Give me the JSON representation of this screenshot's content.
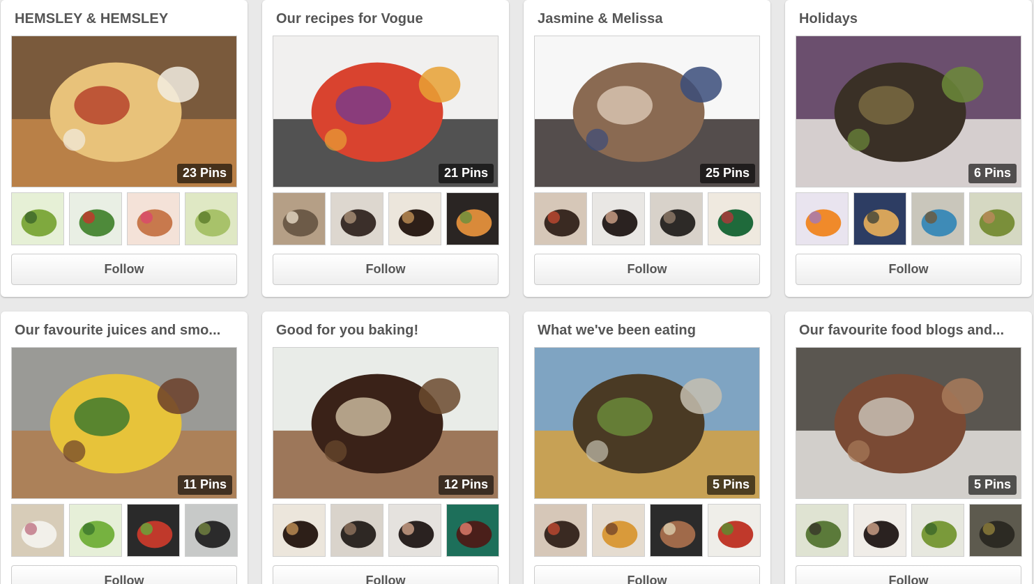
{
  "boards": [
    {
      "title": "HEMSLEY & HEMSLEY",
      "pins_label": "23 Pins",
      "follow_label": "Follow",
      "cover": {
        "image": "pizza-photo",
        "colors": [
          "#7a5a3c",
          "#c98a4a",
          "#e8c27a",
          "#b6432c",
          "#f2ede2"
        ]
      },
      "thumbs": [
        {
          "image": "green-pesto-photo",
          "colors": [
            "#e6f0d6",
            "#7fa93e",
            "#3f6a2a"
          ]
        },
        {
          "image": "salad-photo",
          "colors": [
            "#e9efe4",
            "#4e8a3a",
            "#c0392b"
          ]
        },
        {
          "image": "snacks-photo",
          "colors": [
            "#f4e2d8",
            "#c8794d",
            "#d94b6a"
          ]
        },
        {
          "image": "green-soup-photo",
          "colors": [
            "#dfe8c4",
            "#a8c26a",
            "#5f7f2d"
          ]
        }
      ]
    },
    {
      "title": "Our recipes for Vogue",
      "pins_label": "21 Pins",
      "follow_label": "Follow",
      "cover": {
        "image": "roast-vegetables-tray-photo",
        "colors": [
          "#f1f0ef",
          "#2b2b2b",
          "#d9432f",
          "#7b3b88",
          "#e8a134"
        ]
      },
      "thumbs": [
        {
          "image": "recipe-collage-photo",
          "colors": [
            "#b59f86",
            "#6d5b48",
            "#e1d3bf"
          ]
        },
        {
          "image": "kitchen-people-photo",
          "colors": [
            "#ddd7cf",
            "#3b2f2a",
            "#a58b73"
          ]
        },
        {
          "image": "coffee-cup-photo",
          "colors": [
            "#ece6dc",
            "#2d1f18",
            "#b88952"
          ]
        },
        {
          "image": "stew-pot-photo",
          "colors": [
            "#2a2523",
            "#d98a3a",
            "#6f8f3d"
          ]
        }
      ]
    },
    {
      "title": "Jasmine & Melissa",
      "pins_label": "25 Pins",
      "follow_label": "Follow",
      "cover": {
        "image": "sisters-portrait-photo",
        "colors": [
          "#f7f7f7",
          "#2a2220",
          "#8a6a52",
          "#d7c3b0",
          "#3a4c7a"
        ]
      },
      "thumbs": [
        {
          "image": "sisters-cooking-photo",
          "colors": [
            "#d6c7b8",
            "#3a2a22",
            "#b7462f"
          ]
        },
        {
          "image": "sister-portrait-photo",
          "colors": [
            "#e9e7e4",
            "#2a2220",
            "#c59b84"
          ]
        },
        {
          "image": "sisters-kitchen-photo",
          "colors": [
            "#d8d2ca",
            "#2d2a27",
            "#8b7766"
          ]
        },
        {
          "image": "sisters-standing-photo",
          "colors": [
            "#efe9df",
            "#1f6a3b",
            "#a93a3a"
          ]
        }
      ]
    },
    {
      "title": "Holidays",
      "pins_label": "6 Pins",
      "follow_label": "Follow",
      "cover": {
        "image": "holiday-collage-photo",
        "colors": [
          "#6b4f6e",
          "#f0ede6",
          "#3a3026",
          "#7a6a42",
          "#6c8a3a"
        ]
      },
      "thumbs": [
        {
          "image": "smoothie-colors-photo",
          "colors": [
            "#e9e4ef",
            "#f08a2a",
            "#a77ab0"
          ]
        },
        {
          "image": "sunset-landscape-photo",
          "colors": [
            "#2d3d63",
            "#d7a45a",
            "#4a4a3a"
          ]
        },
        {
          "image": "villa-collage-photo",
          "colors": [
            "#c9c6bb",
            "#3e8bb7",
            "#6a5a42"
          ]
        },
        {
          "image": "garden-collage-photo",
          "colors": [
            "#d5d8c2",
            "#7a8f3a",
            "#b88a5a"
          ]
        }
      ]
    },
    {
      "title": "Our favourite juices and smo...",
      "pins_label": "11 Pins",
      "follow_label": "Follow",
      "cover": {
        "image": "smoothie-ingredients-board-photo",
        "colors": [
          "#9a9a96",
          "#b07a4a",
          "#e7c33a",
          "#3f7a2e",
          "#6b3f2a"
        ]
      },
      "thumbs": [
        {
          "image": "rabbit-photo",
          "colors": [
            "#d7ccb8",
            "#f2f0ea",
            "#c27a8a"
          ]
        },
        {
          "image": "green-juice-photo",
          "colors": [
            "#e6efd8",
            "#76b240",
            "#3f7a2e"
          ]
        },
        {
          "image": "fruit-bowl-photo",
          "colors": [
            "#2a2a2a",
            "#c0392b",
            "#6aa33a"
          ]
        },
        {
          "image": "blender-photo",
          "colors": [
            "#c7c9c8",
            "#2b2b2b",
            "#6f7f3f"
          ]
        }
      ]
    },
    {
      "title": "Good for you baking!",
      "pins_label": "12 Pins",
      "follow_label": "Follow",
      "cover": {
        "image": "chocolate-cake-board-photo",
        "colors": [
          "#e9ece8",
          "#8a5a36",
          "#3a2218",
          "#c9b79c",
          "#6b4a2e"
        ]
      },
      "thumbs": [
        {
          "image": "coffee-cup-photo",
          "colors": [
            "#ece6dc",
            "#2d1f18",
            "#b88952"
          ]
        },
        {
          "image": "sisters-table-photo",
          "colors": [
            "#d9d3cb",
            "#2e2824",
            "#8a6f5a"
          ]
        },
        {
          "image": "sister-cooking-photo",
          "colors": [
            "#e5e2de",
            "#2a2220",
            "#c59b84"
          ]
        },
        {
          "image": "emma-cake-photo",
          "colors": [
            "#1d6f5a",
            "#4a1f1a",
            "#d97a6a"
          ]
        }
      ]
    },
    {
      "title": "What we've been eating",
      "pins_label": "5 Pins",
      "follow_label": "Follow",
      "cover": {
        "image": "banana-peel-photo",
        "colors": [
          "#7fa4c2",
          "#d9a03a",
          "#4a3a24",
          "#6a8a3a",
          "#c5c0b0"
        ]
      },
      "thumbs": [
        {
          "image": "sisters-cooking-photo",
          "colors": [
            "#d6c7b8",
            "#3a2a22",
            "#b7462f"
          ]
        },
        {
          "image": "tartlets-photo",
          "colors": [
            "#e5dcd0",
            "#d99a3a",
            "#7a4a2a"
          ]
        },
        {
          "image": "roast-tray-photo",
          "colors": [
            "#2b2b2b",
            "#a06a4a",
            "#d7c7a7"
          ]
        },
        {
          "image": "salad-plate-photo",
          "colors": [
            "#efeee9",
            "#c0392b",
            "#5f8a2f"
          ]
        }
      ]
    },
    {
      "title": "Our favourite food blogs and...",
      "pins_label": "5 Pins",
      "follow_label": "Follow",
      "cover": {
        "image": "energy-balls-photo",
        "colors": [
          "#5a5650",
          "#f0eeea",
          "#7a4a34",
          "#c8bfb5",
          "#a87a5a"
        ]
      },
      "thumbs": [
        {
          "image": "riverford-sign-photo",
          "colors": [
            "#dfe3d2",
            "#5b7a3a",
            "#3a3a2a"
          ]
        },
        {
          "image": "sisters-portrait-photo",
          "colors": [
            "#f0ede8",
            "#2a2220",
            "#c59b84"
          ]
        },
        {
          "image": "salad-bowl-photo",
          "colors": [
            "#e7e8df",
            "#7a9a3a",
            "#3f6a2a"
          ]
        },
        {
          "image": "dark-dish-photo",
          "colors": [
            "#5d5a4e",
            "#2c2a23",
            "#8a7a3a"
          ]
        }
      ]
    }
  ]
}
